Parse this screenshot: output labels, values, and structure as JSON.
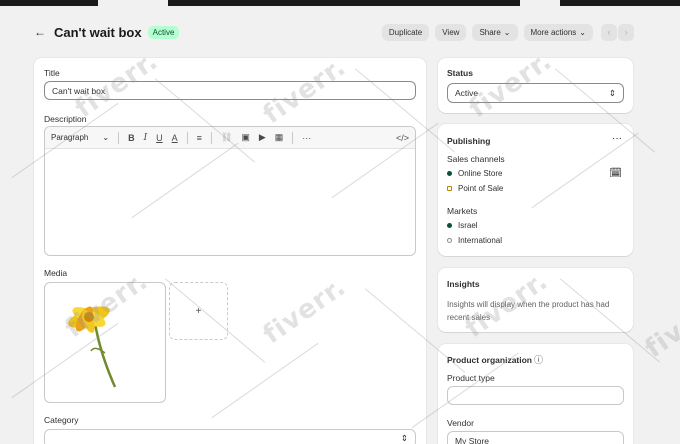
{
  "header": {
    "title": "Can't wait box",
    "status_badge": "Active",
    "actions": {
      "duplicate": "Duplicate",
      "view": "View",
      "share": "Share",
      "more": "More actions"
    }
  },
  "title_section": {
    "label": "Title",
    "value": "Can't wait box"
  },
  "description": {
    "label": "Description",
    "format": "Paragraph"
  },
  "media": {
    "label": "Media",
    "add_symbol": "+"
  },
  "category": {
    "label": "Category"
  },
  "status": {
    "label": "Status",
    "value": "Active"
  },
  "publishing": {
    "title": "Publishing",
    "sales_channels_label": "Sales channels",
    "channels": [
      {
        "name": "Online Store",
        "state": "active"
      },
      {
        "name": "Point of Sale",
        "state": "pending"
      }
    ],
    "markets_label": "Markets",
    "markets": [
      {
        "name": "Israel",
        "state": "active"
      },
      {
        "name": "International",
        "state": "inactive"
      }
    ]
  },
  "insights": {
    "title": "Insights",
    "text": "Insights will display when the product has had recent sales"
  },
  "organization": {
    "title": "Product organization",
    "product_type_label": "Product type",
    "product_type_value": "",
    "vendor_label": "Vendor",
    "vendor_value": "My Store"
  },
  "watermark": "fiverr.",
  "colors": {
    "badge_bg": "#b4fed2",
    "badge_text": "#0c5132",
    "active_dot": "#0c5132",
    "page_bg": "#f1f1f1"
  }
}
